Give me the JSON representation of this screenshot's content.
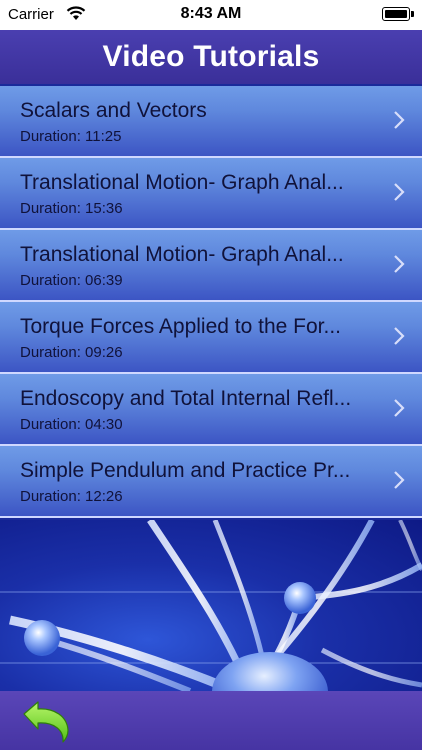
{
  "status": {
    "carrier": "Carrier",
    "time": "8:43 AM"
  },
  "header": {
    "title": "Video Tutorials"
  },
  "videos": [
    {
      "title": "Scalars and Vectors",
      "duration": "Duration: 11:25"
    },
    {
      "title": "Translational Motion- Graph Anal...",
      "duration": "Duration: 15:36"
    },
    {
      "title": "Translational Motion- Graph Anal...",
      "duration": "Duration: 06:39"
    },
    {
      "title": "Torque Forces Applied to the For...",
      "duration": "Duration: 09:26"
    },
    {
      "title": "Endoscopy and Total Internal Refl...",
      "duration": "Duration: 04:30"
    },
    {
      "title": "Simple Pendulum and Practice Pr...",
      "duration": "Duration: 12:26"
    }
  ],
  "icons": {
    "back": "back-arrow-icon",
    "chevron": "chevron-right-icon",
    "wifi": "wifi-icon",
    "battery": "battery-icon"
  },
  "colors": {
    "header": "#3f35a6",
    "row_top": "#6f9be7",
    "row_bottom": "#3c55c4",
    "back_arrow": "#7ee020"
  }
}
